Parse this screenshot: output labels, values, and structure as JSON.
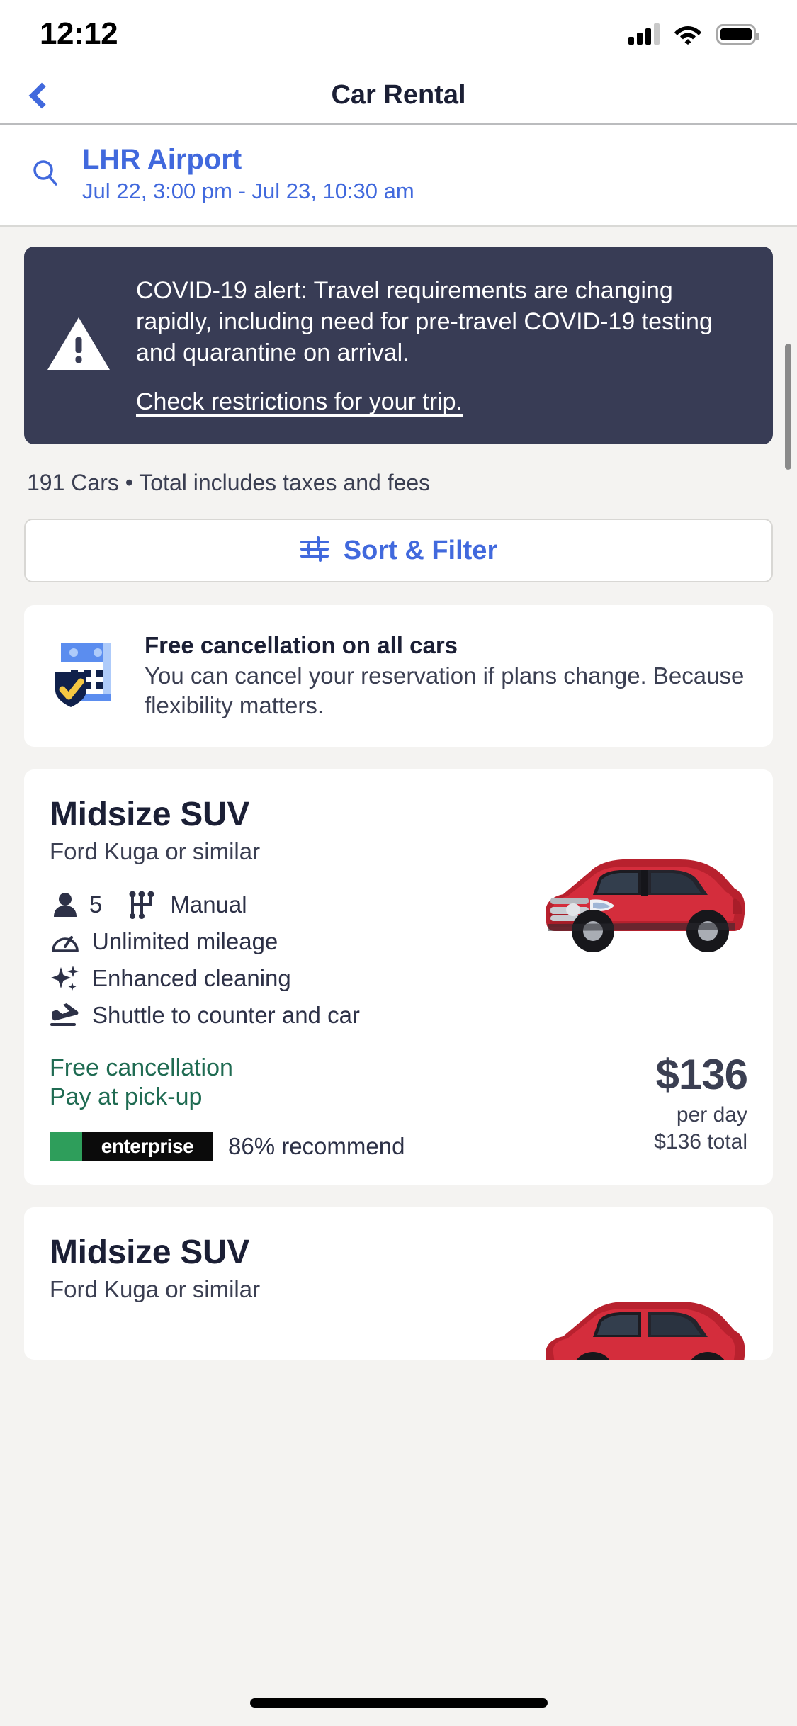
{
  "status_bar": {
    "time": "12:12",
    "signal_icon": "cellular-signal-icon",
    "wifi_icon": "wifi-icon",
    "battery_icon": "battery-full-icon"
  },
  "header": {
    "title": "Car Rental",
    "back_icon": "back-chevron-icon"
  },
  "search": {
    "icon": "search-icon",
    "location": "LHR Airport",
    "dates": "Jul 22, 3:00 pm - Jul 23, 10:30 am"
  },
  "covid_banner": {
    "icon": "warning-triangle-icon",
    "text": "COVID-19 alert: Travel requirements are changing rapidly, including need for pre-travel COVID-19 testing and quarantine on arrival.",
    "link": "Check restrictions for your trip.",
    "bg_color": "#383c55"
  },
  "results_summary": "191 Cars • Total includes taxes and fees",
  "sort_filter": {
    "icon": "sliders-filter-icon",
    "label": "Sort & Filter",
    "accent_color": "#4169dd"
  },
  "cancellation_info": {
    "icon": "calendar-shield-check-icon",
    "title": "Free cancellation on all cars",
    "description": "You can cancel your reservation if plans change. Because flexibility matters."
  },
  "cars": [
    {
      "title": "Midsize SUV",
      "subtitle": "Ford Kuga or similar",
      "image": "red-suv-image",
      "seats_icon": "person-icon",
      "seats": "5",
      "transmission_icon": "gear-shift-icon",
      "transmission": "Manual",
      "features": [
        {
          "icon": "speedometer-icon",
          "label": "Unlimited mileage"
        },
        {
          "icon": "sparkle-icon",
          "label": "Enhanced cleaning"
        },
        {
          "icon": "plane-landing-icon",
          "label": "Shuttle to counter and car"
        }
      ],
      "free_cancellation": "Free cancellation",
      "pay_at_pickup": "Pay at pick-up",
      "vendor": "enterprise",
      "recommend": "86% recommend",
      "price": "$136",
      "price_unit": "per day",
      "price_total": "$136 total",
      "cancellation_color": "#1f6b52"
    },
    {
      "title": "Midsize SUV",
      "subtitle": "Ford Kuga or similar",
      "image": "red-suv-image"
    }
  ]
}
